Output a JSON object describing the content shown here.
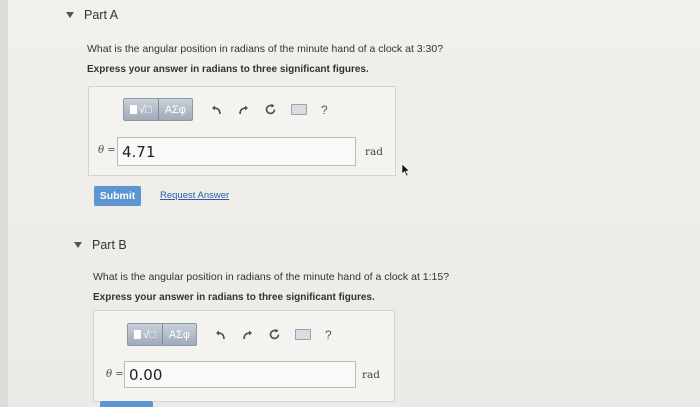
{
  "part_a": {
    "title": "Part A",
    "question": "What is the angular position in radians of the minute hand of a clock at 3:30?",
    "hint": "Express your answer in radians to three significant figures.",
    "toolbar": {
      "templates": "√□",
      "symbols": "ΑΣφ",
      "help": "?"
    },
    "variable": "θ =",
    "value": "4.71",
    "unit": "rad",
    "submit_label": "Submit",
    "request_answer_label": "Request Answer"
  },
  "part_b": {
    "title": "Part B",
    "question": "What is the angular position in radians of the minute hand of a clock at 1:15?",
    "hint": "Express your answer in radians to three significant figures.",
    "toolbar": {
      "templates": "√□",
      "symbols": "ΑΣφ",
      "help": "?"
    },
    "variable": "θ =",
    "value": "0.00",
    "unit": "rad"
  }
}
